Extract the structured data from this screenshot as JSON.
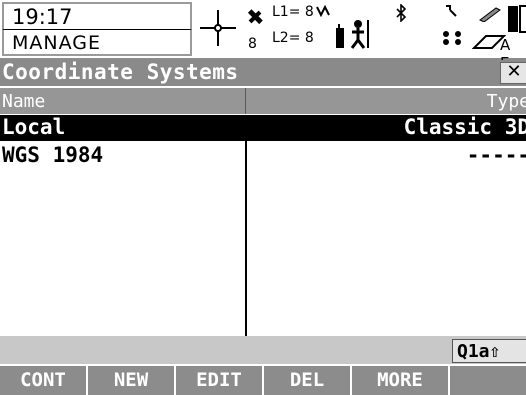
{
  "status": {
    "time": "19:17",
    "mode": "MANAGE",
    "sat_count": "8",
    "l1_label": "L1= 8",
    "l2_label": "L2= 8",
    "battery_label": "A E"
  },
  "title": {
    "text": "Coordinate Systems",
    "close_label": "✕"
  },
  "columns": {
    "name": "Name",
    "type": "Type"
  },
  "rows": [
    {
      "name": "Local",
      "type": "Classic 3D",
      "selected": true
    },
    {
      "name": "WGS 1984",
      "type": "-----",
      "selected": false
    }
  ],
  "input_indicator": "Q1a⇧",
  "softkeys": [
    "CONT",
    "NEW",
    "EDIT",
    "DEL",
    "MORE",
    ""
  ],
  "colors": {
    "title_bg": "#8a8a8a",
    "header_bg": "#969696",
    "selected_bg": "#000000",
    "softkey_bg": "#8c8c8c"
  }
}
